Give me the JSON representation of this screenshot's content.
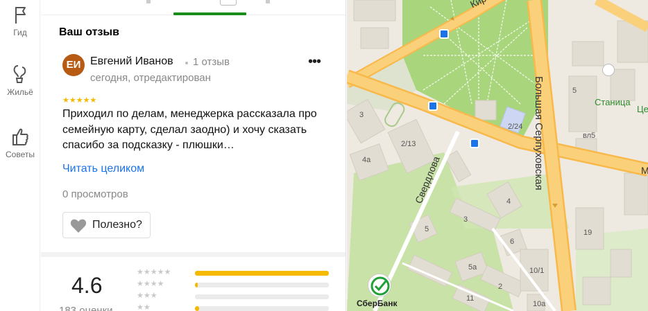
{
  "rail": {
    "items": [
      {
        "label": "Гид",
        "icon": "flag-icon"
      },
      {
        "label": "Жильё",
        "icon": "balloon-icon"
      },
      {
        "label": "Советы",
        "icon": "thumbs-up-icon"
      }
    ]
  },
  "review_section": {
    "title": "Ваш отзыв",
    "author_initials": "ЕИ",
    "author_name": "Евгений Иванов",
    "author_reviews": "1 отзыв",
    "date": "сегодня, отредактирован",
    "rating_stars": 5,
    "stars_text": "★★★★★",
    "text": "Приходил по делам, менеджерка рассказала про семейную карту, сделал заодно) и хочу сказать спасибо за подсказку - плюшки…",
    "read_more": "Читать целиком",
    "views": "0 просмотров",
    "useful_label": "Полезно?",
    "more_glyph": "•••"
  },
  "rating": {
    "value": "4.6",
    "count": "183 оценки",
    "distribution": [
      {
        "stars": "★★★★★",
        "fraction": 1.0
      },
      {
        "stars": "★★★★",
        "fraction": 0.02
      },
      {
        "stars": "★★★",
        "fraction": 0.0
      },
      {
        "stars": "★★",
        "fraction": 0.03
      }
    ]
  },
  "map": {
    "streets": [
      "Кирова",
      "Большая Серпуховская",
      "Свердлова",
      "М"
    ],
    "labels": [
      "3",
      "2/13",
      "4a",
      "2/24",
      "4",
      "3",
      "5",
      "6",
      "5a",
      "10/1",
      "2",
      "11",
      "10a",
      "19",
      "вл5",
      "5"
    ],
    "poi": [
      "Станица",
      "Це",
      "СберБанк"
    ],
    "colors": {
      "park": "#a9d67c",
      "road": "#f8b94a",
      "bus": "#1a73e8",
      "sber": "#21a038"
    }
  }
}
